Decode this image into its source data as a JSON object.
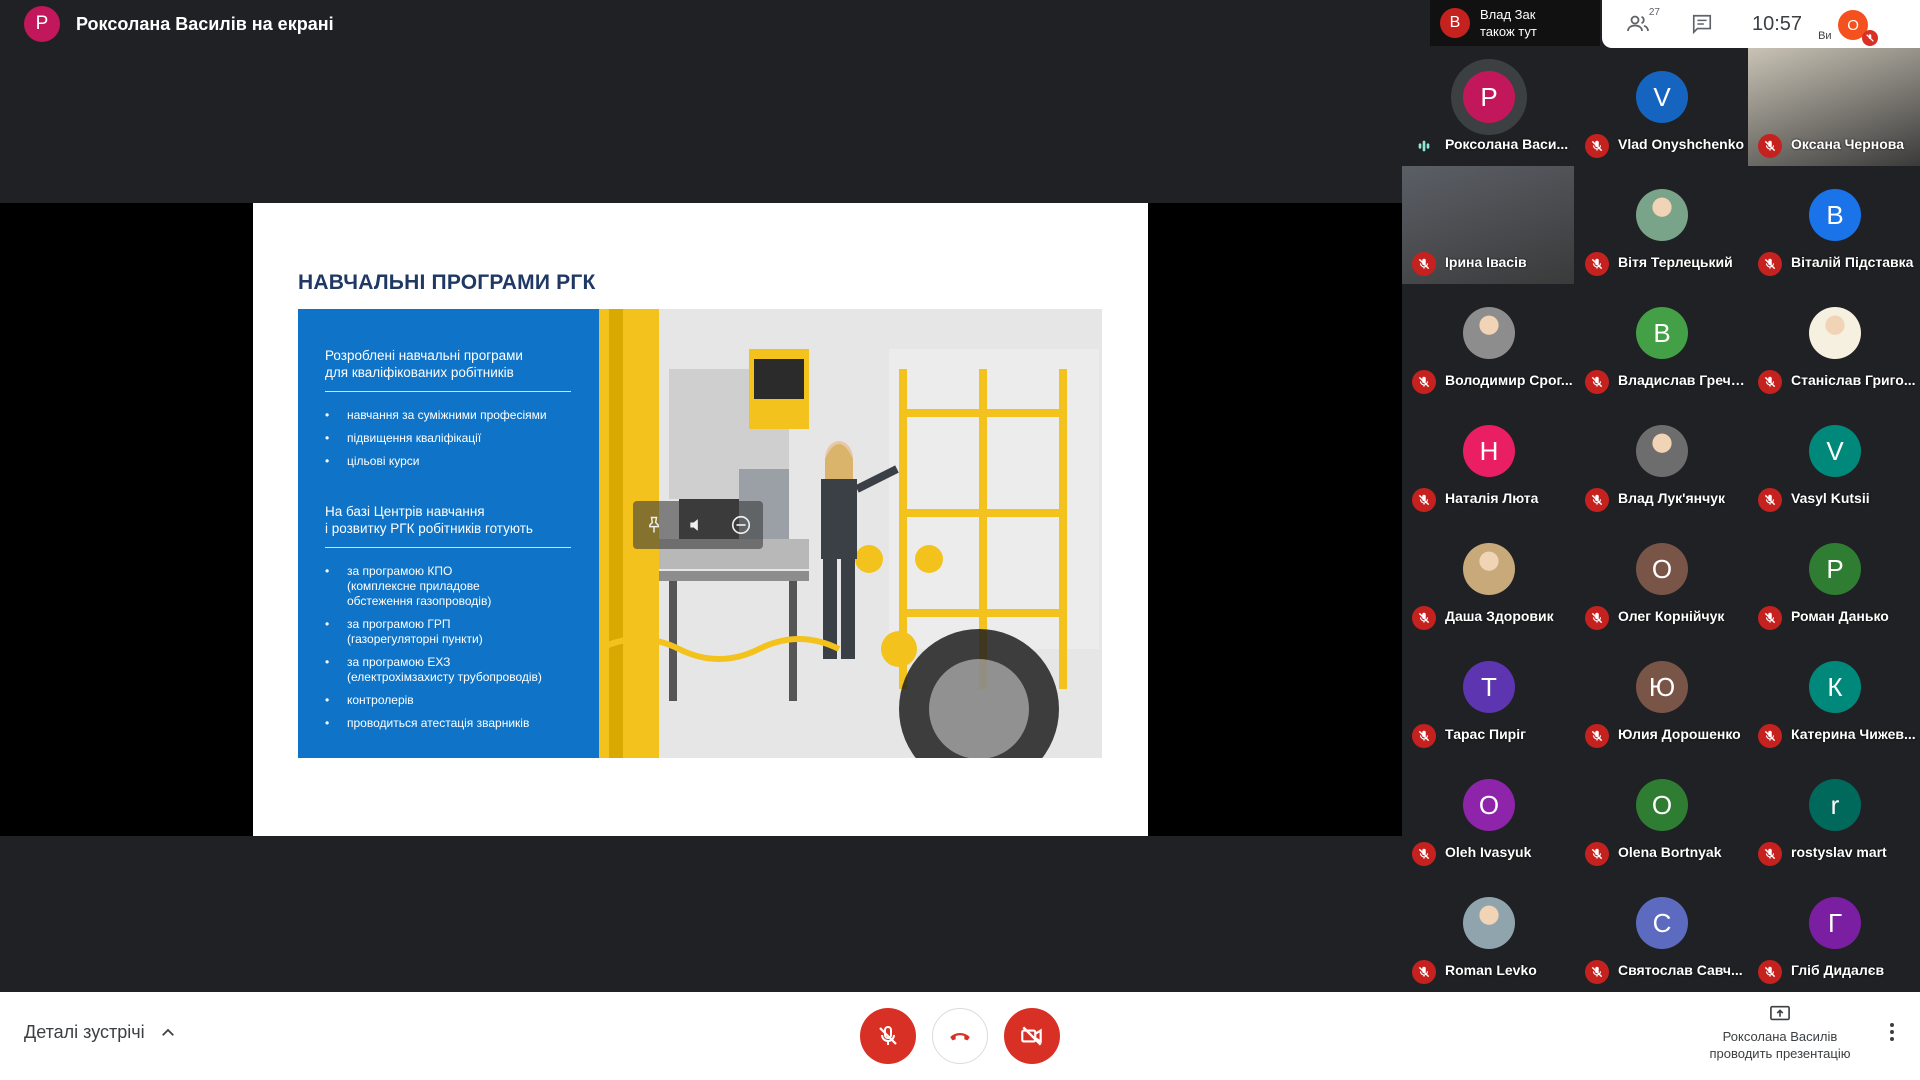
{
  "header": {
    "presenter_initial": "Р",
    "presenter_title": "Роксолана Василів на екрані",
    "also_here": {
      "initial": "В",
      "line1": "Влад Зак",
      "line2": "також тут"
    },
    "people_count": "27",
    "time": "10:57",
    "self_initial": "О",
    "self_label": "Ви"
  },
  "colors": {
    "red": "#d93025",
    "blue": "#0f74c7",
    "dark": "#202124"
  },
  "slide": {
    "title": "НАВЧАЛЬНІ ПРОГРАМИ РГК",
    "block1_heading_line1": "Розроблені навчальні програми",
    "block1_heading_line2": "для кваліфікованих робітників",
    "block1_items": [
      "навчання за суміжними професіями",
      "підвищення кваліфікації",
      "цільові курси"
    ],
    "block2_heading_line1": "На базі Центрів навчання",
    "block2_heading_line2": "і розвитку РГК робітників готують",
    "block2_items": [
      {
        "l1": "за програмою КПО",
        "l2": "(комплексне приладове",
        "l3": "обстеження газопроводів)"
      },
      {
        "l1": "за програмою ГРП",
        "l2": "(газорегуляторні пункти)",
        "l3": ""
      },
      {
        "l1": "за програмою ЕХЗ",
        "l2": "(електрохімзахисту трубопроводів)",
        "l3": ""
      },
      {
        "l1": "контролерів",
        "l2": "",
        "l3": ""
      },
      {
        "l1": "проводиться атестація зварників",
        "l2": "",
        "l3": ""
      }
    ]
  },
  "participants": [
    {
      "name": "Роксолана Васи...",
      "initial": "Р",
      "color": "#c2185b",
      "speaking": true
    },
    {
      "name": "Vlad Onyshchenko",
      "initial": "V",
      "color": "#1565c0"
    },
    {
      "name": "Оксана Чернова",
      "initial": "",
      "color": "#c9c3b5",
      "video": true
    },
    {
      "name": "Ірина Івасів",
      "initial": "",
      "color": "#5b5f66",
      "video": true
    },
    {
      "name": "Вітя Терлецький",
      "initial": "",
      "color": "#7aa48a",
      "photo": true
    },
    {
      "name": "Віталій Підставка",
      "initial": "В",
      "color": "#1a73e8"
    },
    {
      "name": "Володимир Срог...",
      "initial": "",
      "color": "#8d8d8d",
      "photo": true
    },
    {
      "name": "Владислав Гречк...",
      "initial": "В",
      "color": "#43a047"
    },
    {
      "name": "Станіслав Григо...",
      "initial": "",
      "color": "#f5f0e0",
      "photo": true
    },
    {
      "name": "Наталія Люта",
      "initial": "Н",
      "color": "#e91e63"
    },
    {
      "name": "Влад Лук'янчук",
      "initial": "",
      "color": "#6d6d6d",
      "photo": true
    },
    {
      "name": "Vasyl Kutsii",
      "initial": "V",
      "color": "#00897b"
    },
    {
      "name": "Даша Здоровик",
      "initial": "",
      "color": "#c8a97a",
      "photo": true
    },
    {
      "name": "Олег Корнійчук",
      "initial": "О",
      "color": "#795548"
    },
    {
      "name": "Роман Данько",
      "initial": "Р",
      "color": "#2e7d32"
    },
    {
      "name": "Тарас Пиріг",
      "initial": "Т",
      "color": "#5e35b1"
    },
    {
      "name": "Юлия Дорошенко",
      "initial": "Ю",
      "color": "#795548"
    },
    {
      "name": "Катерина Чижев...",
      "initial": "К",
      "color": "#00897b"
    },
    {
      "name": "Oleh Ivasyuk",
      "initial": "О",
      "color": "#8e24aa"
    },
    {
      "name": "Olena Bortnyak",
      "initial": "О",
      "color": "#2e7d32"
    },
    {
      "name": "rostyslav mart",
      "initial": "r",
      "color": "#00695c"
    },
    {
      "name": "Roman Levko",
      "initial": "",
      "color": "#90a4ae",
      "photo": true
    },
    {
      "name": "Святослав Савч...",
      "initial": "С",
      "color": "#5c6bc0"
    },
    {
      "name": "Гліб Дидалєв",
      "initial": "Г",
      "color": "#7b1fa2"
    }
  ],
  "footer": {
    "details_label": "Деталі зустрічі",
    "presenting_line1": "Роксолана Василів",
    "presenting_line2": "проводить презентацію"
  }
}
